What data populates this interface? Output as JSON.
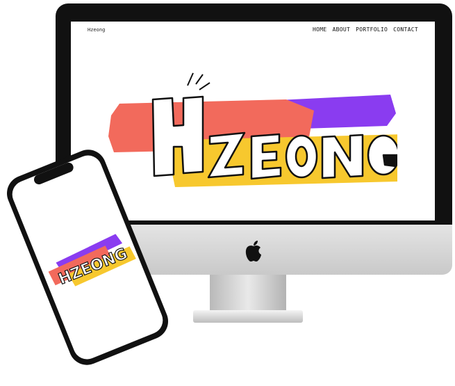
{
  "site": {
    "brand": "Hzeong",
    "nav": [
      "HOME",
      "ABOUT",
      "PORTFOLIO",
      "CONTACT"
    ],
    "hero_wordmark": "HZEONG"
  },
  "colors": {
    "coral": "#f26a5c",
    "purple": "#8a3cf0",
    "yellow": "#f7c82e",
    "frame": "#111111"
  }
}
